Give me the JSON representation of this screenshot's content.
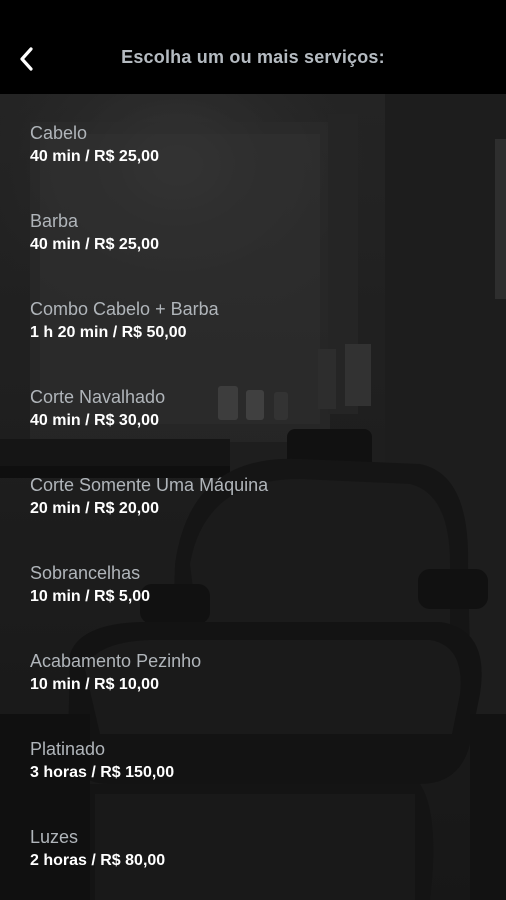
{
  "header": {
    "title": "Escolha um ou mais serviços:",
    "back_icon": "chevron-left-icon"
  },
  "colors": {
    "header_background": "#000000",
    "title_text": "#b5bbc1",
    "service_name_text": "#b0b5ba",
    "service_details_text": "#ffffff"
  },
  "services": [
    {
      "name": "Cabelo",
      "details": "40 min / R$ 25,00"
    },
    {
      "name": "Barba",
      "details": "40 min / R$ 25,00"
    },
    {
      "name": "Combo Cabelo + Barba",
      "details": "1 h 20 min / R$ 50,00"
    },
    {
      "name": "Corte Navalhado",
      "details": "40 min / R$ 30,00"
    },
    {
      "name": "Corte Somente Uma Máquina",
      "details": "20 min / R$ 20,00"
    },
    {
      "name": "Sobrancelhas",
      "details": "10 min / R$ 5,00"
    },
    {
      "name": "Acabamento Pezinho",
      "details": "10 min / R$ 10,00"
    },
    {
      "name": "Platinado",
      "details": "3 horas / R$ 150,00"
    },
    {
      "name": "Luzes",
      "details": "2 horas / R$ 80,00"
    }
  ]
}
